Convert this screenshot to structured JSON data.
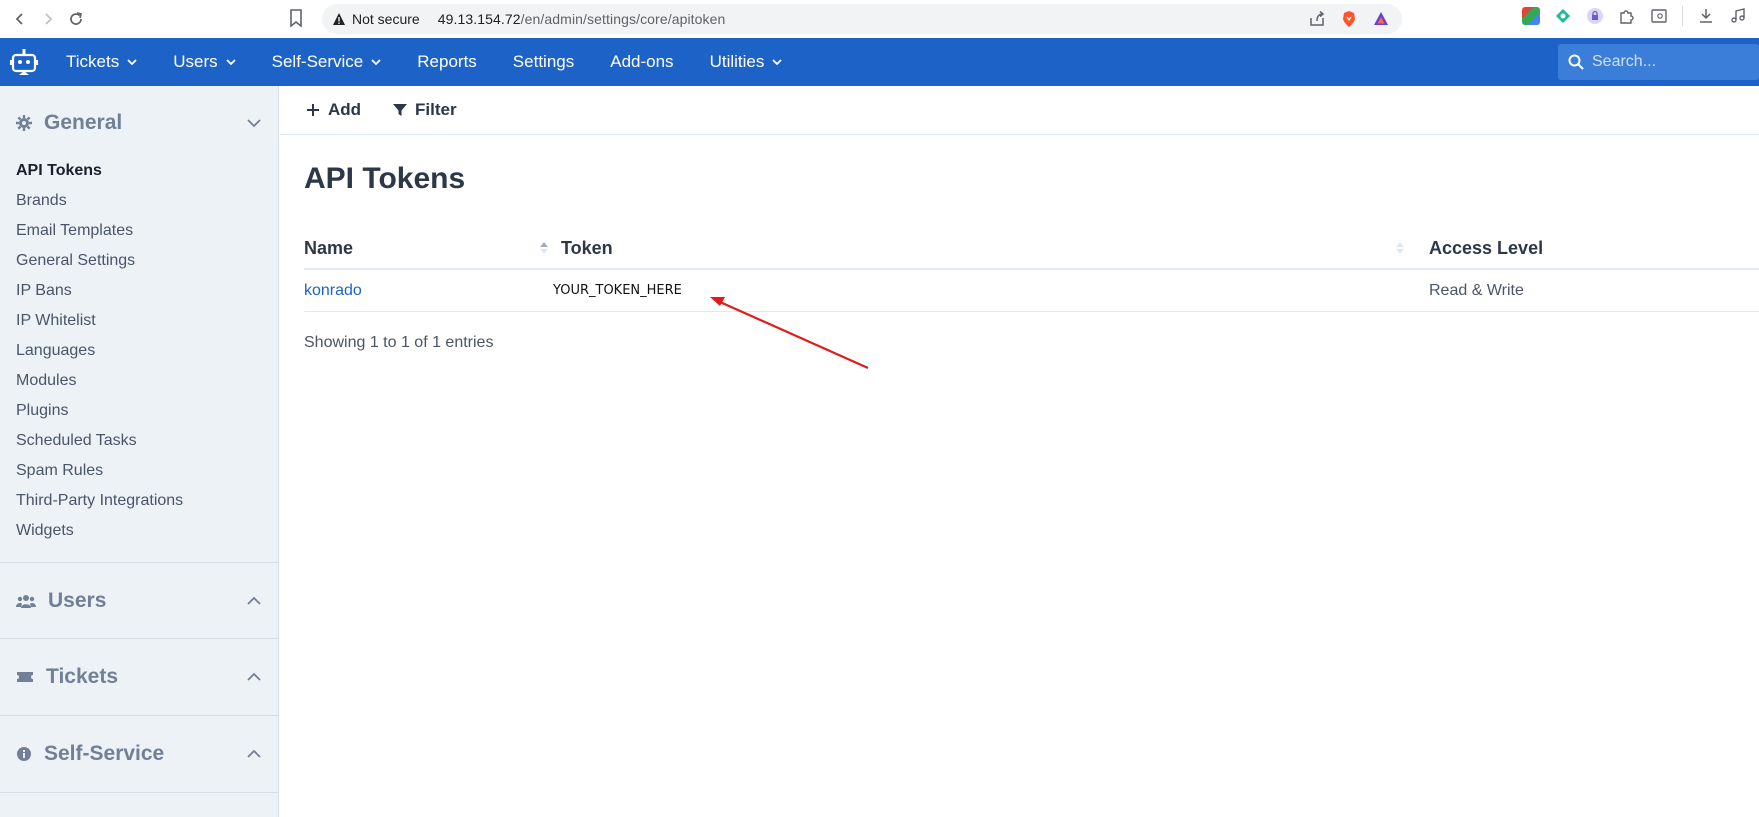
{
  "browser": {
    "security_label": "Not secure",
    "url_host": "49.13.154.72",
    "url_path": "/en/admin/settings/core/apitoken"
  },
  "topnav": {
    "items": [
      {
        "label": "Tickets",
        "has_dropdown": true
      },
      {
        "label": "Users",
        "has_dropdown": true
      },
      {
        "label": "Self-Service",
        "has_dropdown": true
      },
      {
        "label": "Reports",
        "has_dropdown": false
      },
      {
        "label": "Settings",
        "has_dropdown": false
      },
      {
        "label": "Add-ons",
        "has_dropdown": false
      },
      {
        "label": "Utilities",
        "has_dropdown": true
      }
    ],
    "search_placeholder": "Search..."
  },
  "sidebar": {
    "general": {
      "title": "General",
      "items": [
        "API Tokens",
        "Brands",
        "Email Templates",
        "General Settings",
        "IP Bans",
        "IP Whitelist",
        "Languages",
        "Modules",
        "Plugins",
        "Scheduled Tasks",
        "Spam Rules",
        "Third-Party Integrations",
        "Widgets"
      ]
    },
    "users": {
      "title": "Users"
    },
    "tickets": {
      "title": "Tickets"
    },
    "self_service": {
      "title": "Self-Service"
    }
  },
  "toolbar": {
    "add_label": "Add",
    "filter_label": "Filter"
  },
  "page": {
    "title": "API Tokens"
  },
  "table": {
    "headers": {
      "name": "Name",
      "token": "Token",
      "access": "Access Level"
    },
    "rows": [
      {
        "name": "konrado",
        "token": "YOUR_TOKEN_HERE",
        "access": "Read & Write"
      }
    ],
    "footer": "Showing 1 to 1 of 1 entries"
  },
  "colors": {
    "brand": "#1d63c7",
    "annotation_arrow": "#e3191a"
  }
}
